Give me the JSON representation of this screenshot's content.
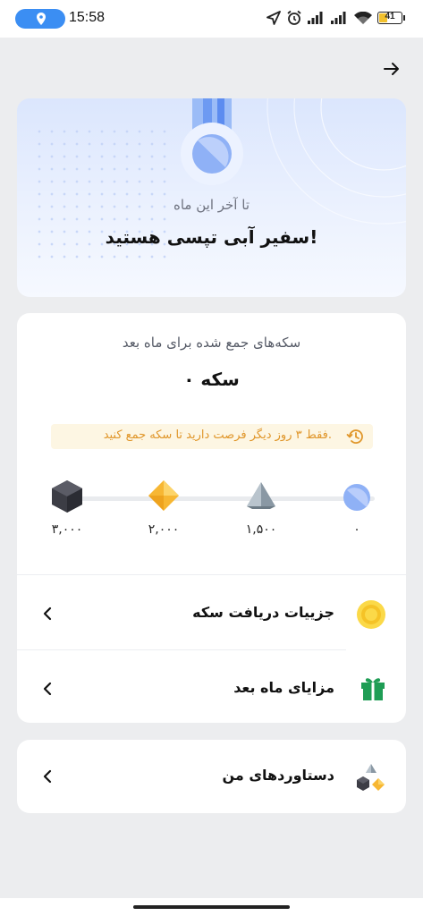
{
  "status_bar": {
    "time": "15:58",
    "battery_level": "41",
    "battery_fraction": 0.41,
    "icons": [
      "location-icon",
      "navigation-arrow-icon",
      "alarm-icon",
      "signal-icon",
      "signal-icon",
      "wifi-icon",
      "battery-icon"
    ]
  },
  "header": {
    "back_icon": "arrow-right-icon"
  },
  "hero": {
    "subtitle": "تا آخر این ماه",
    "title": "سفیر آبی تپسی هستید!",
    "medal_icon": "blue-medal-icon"
  },
  "coins": {
    "subtitle": "سکه‌های جمع شده برای ماه بعد",
    "count": "۰ سکه",
    "notice": "فقط ۳ روز دیگر فرصت دارید تا سکه جمع کنید.",
    "notice_icon": "history-clock-icon",
    "progress_fraction": 0,
    "milestones": [
      {
        "label": "۰",
        "icon": "blue-circle-badge-icon"
      },
      {
        "label": "۱,۵۰۰",
        "icon": "silver-pyramid-badge-icon"
      },
      {
        "label": "۲,۰۰۰",
        "icon": "gold-diamond-badge-icon"
      },
      {
        "label": "۳,۰۰۰",
        "icon": "dark-hexagon-badge-icon"
      }
    ]
  },
  "menu": {
    "coin_details": {
      "label": "جزییات دریافت سکه",
      "icon": "gold-coin-icon"
    },
    "next_month_benefits": {
      "label": "مزایای ماه بعد",
      "icon": "gift-icon"
    },
    "my_achievements": {
      "label": "دستاوردهای من",
      "icon": "badges-icon"
    }
  },
  "colors": {
    "accent_blue": "#7ea6f6",
    "notice_text": "#e0962a",
    "notice_bg": "#fdf6e3",
    "gift_green": "#1f9d55",
    "coin_gold": "#f7c93a"
  }
}
